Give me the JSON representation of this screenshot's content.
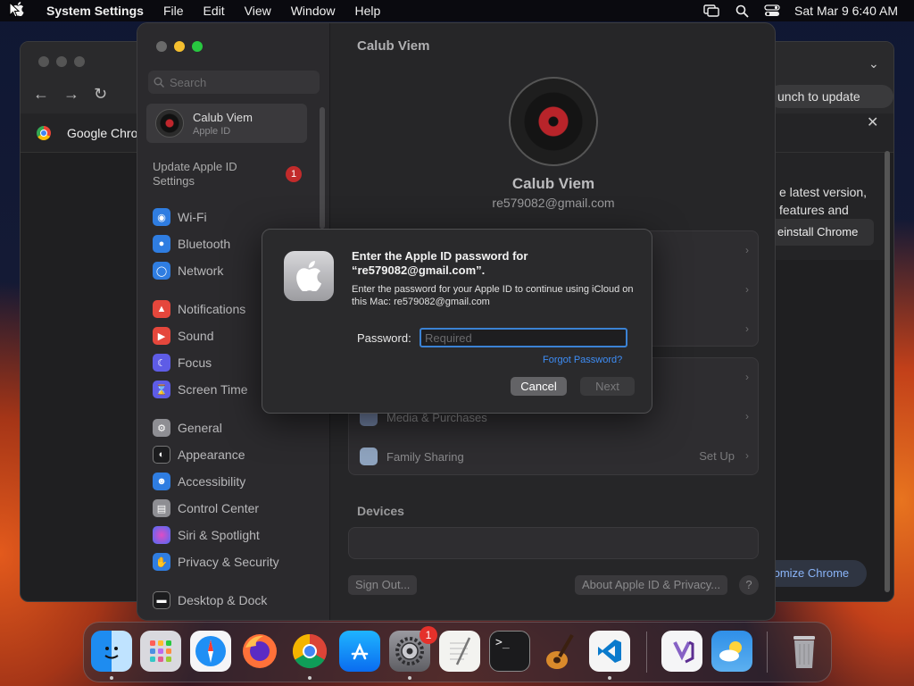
{
  "menubar": {
    "app_name": "System Settings",
    "menus": [
      "File",
      "Edit",
      "View",
      "Window",
      "Help"
    ],
    "clock": "Sat Mar 9  6:40 AM"
  },
  "chrome": {
    "tab_title": "Google Chrome",
    "relaunch_label": "unch to update",
    "panel_text_1": "e latest version,",
    "panel_text_2": "features and",
    "reinstall_label": "einstall Chrome",
    "customize_label": "tomize Chrome"
  },
  "sidebar": {
    "search_placeholder": "Search",
    "apple_id_name": "Calub Viem",
    "apple_id_sub": "Apple ID",
    "update_label": "Update Apple ID Settings",
    "update_badge": "1",
    "items": [
      {
        "label": "Wi-Fi",
        "icon": "wifi-icon",
        "color": "#2f7de1"
      },
      {
        "label": "Bluetooth",
        "icon": "bluetooth-icon",
        "color": "#2f7de1"
      },
      {
        "label": "Network",
        "icon": "globe-icon",
        "color": "#2f7de1"
      },
      {
        "label": "Notifications",
        "icon": "bell-icon",
        "color": "#e5473c"
      },
      {
        "label": "Sound",
        "icon": "speaker-icon",
        "color": "#e5473c"
      },
      {
        "label": "Focus",
        "icon": "moon-icon",
        "color": "#5e5ce6"
      },
      {
        "label": "Screen Time",
        "icon": "hourglass-icon",
        "color": "#5e5ce6"
      },
      {
        "label": "General",
        "icon": "gear-icon",
        "color": "#8e8e93"
      },
      {
        "label": "Appearance",
        "icon": "appearance-icon",
        "color": "#1c1c1e"
      },
      {
        "label": "Accessibility",
        "icon": "accessibility-icon",
        "color": "#2f7de1"
      },
      {
        "label": "Control Center",
        "icon": "control-center-icon",
        "color": "#8e8e93"
      },
      {
        "label": "Siri & Spotlight",
        "icon": "siri-icon",
        "color": "#b04fd6"
      },
      {
        "label": "Privacy & Security",
        "icon": "hand-icon",
        "color": "#2f7de1"
      },
      {
        "label": "Desktop & Dock",
        "icon": "dock-icon",
        "color": "#1c1c1e"
      }
    ]
  },
  "content": {
    "title": "Calub Viem",
    "name": "Calub Viem",
    "email": "re579082@gmail.com",
    "media_label": "Media & Purchases",
    "family_label": "Family Sharing",
    "family_action": "Set Up",
    "devices_title": "Devices",
    "sign_out_label": "Sign Out...",
    "about_label": "About Apple ID & Privacy...",
    "help_label": "?"
  },
  "dialog": {
    "title": "Enter the Apple ID password for “re579082@gmail.com”.",
    "body": "Enter the password for your Apple ID to continue using iCloud on this Mac: re579082@gmail.com",
    "password_label": "Password:",
    "password_placeholder": "Required",
    "forgot_label": "Forgot Password?",
    "cancel_label": "Cancel",
    "next_label": "Next"
  },
  "dock": {
    "apps": [
      {
        "name": "finder",
        "running": true
      },
      {
        "name": "launchpad",
        "running": false
      },
      {
        "name": "safari",
        "running": false
      },
      {
        "name": "firefox",
        "running": false
      },
      {
        "name": "chrome",
        "running": true
      },
      {
        "name": "app-store",
        "running": false
      },
      {
        "name": "system-settings",
        "running": true,
        "badge": "1"
      },
      {
        "name": "textedit",
        "running": false
      },
      {
        "name": "terminal",
        "running": false
      },
      {
        "name": "garageband",
        "running": false
      },
      {
        "name": "vscode",
        "running": true
      },
      {
        "name": "visual-studio",
        "running": false
      },
      {
        "name": "weather",
        "running": false
      },
      {
        "name": "trash",
        "running": false
      }
    ]
  }
}
